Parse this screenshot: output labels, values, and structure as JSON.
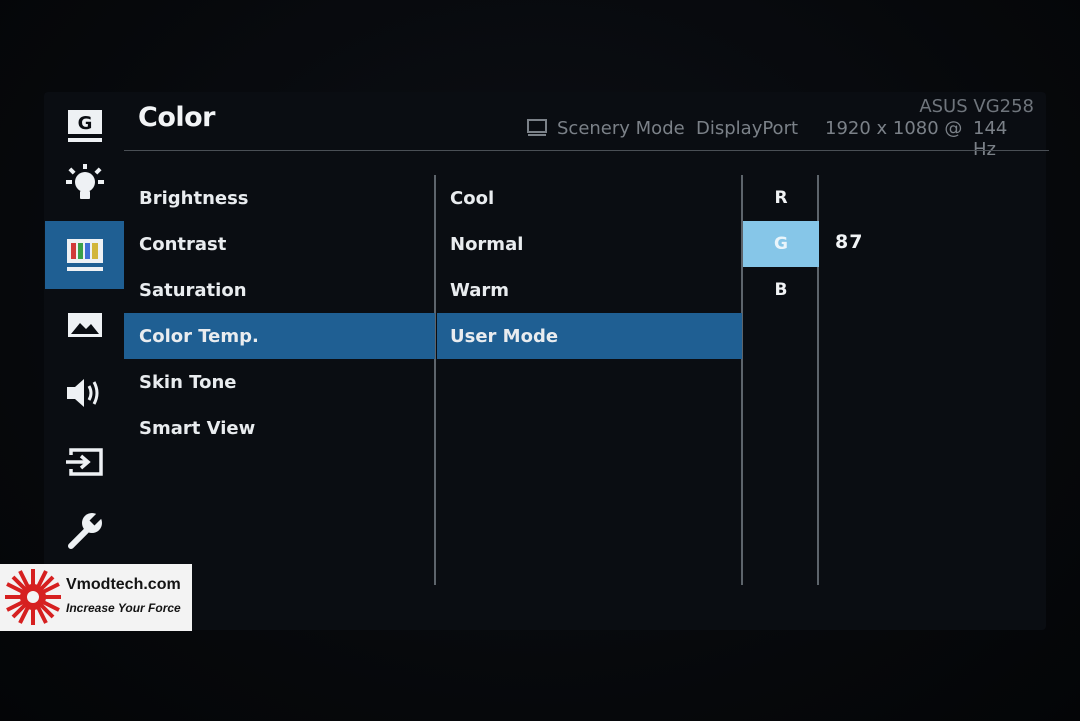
{
  "header": {
    "title": "Color",
    "model": "ASUS VG258",
    "mode": "Scenery Mode",
    "input": "DisplayPort",
    "resolution": "1920 x 1080 @",
    "refresh": "144 Hz"
  },
  "rail": [
    {
      "icon": "gamevisual-icon"
    },
    {
      "icon": "blue-light-filter-icon"
    },
    {
      "icon": "color-icon"
    },
    {
      "icon": "image-icon"
    },
    {
      "icon": "sound-icon"
    },
    {
      "icon": "input-select-icon"
    },
    {
      "icon": "system-setup-icon"
    }
  ],
  "menu": {
    "items": [
      "Brightness",
      "Contrast",
      "Saturation",
      "Color Temp.",
      "Skin Tone",
      "Smart View"
    ],
    "selected": "Color Temp."
  },
  "color_temp": {
    "items": [
      "Cool",
      "Normal",
      "Warm",
      "User Mode"
    ],
    "selected": "User Mode"
  },
  "rgb": {
    "channels": [
      "R",
      "G",
      "B"
    ],
    "selected": "G",
    "value": "87"
  },
  "watermark": {
    "site": "Vmodtech.com",
    "tagline": "Increase Your Force"
  },
  "colors": {
    "accent": "#1f5f93",
    "channel_highlight": "#86c6e8",
    "background": "#0a0d12"
  }
}
